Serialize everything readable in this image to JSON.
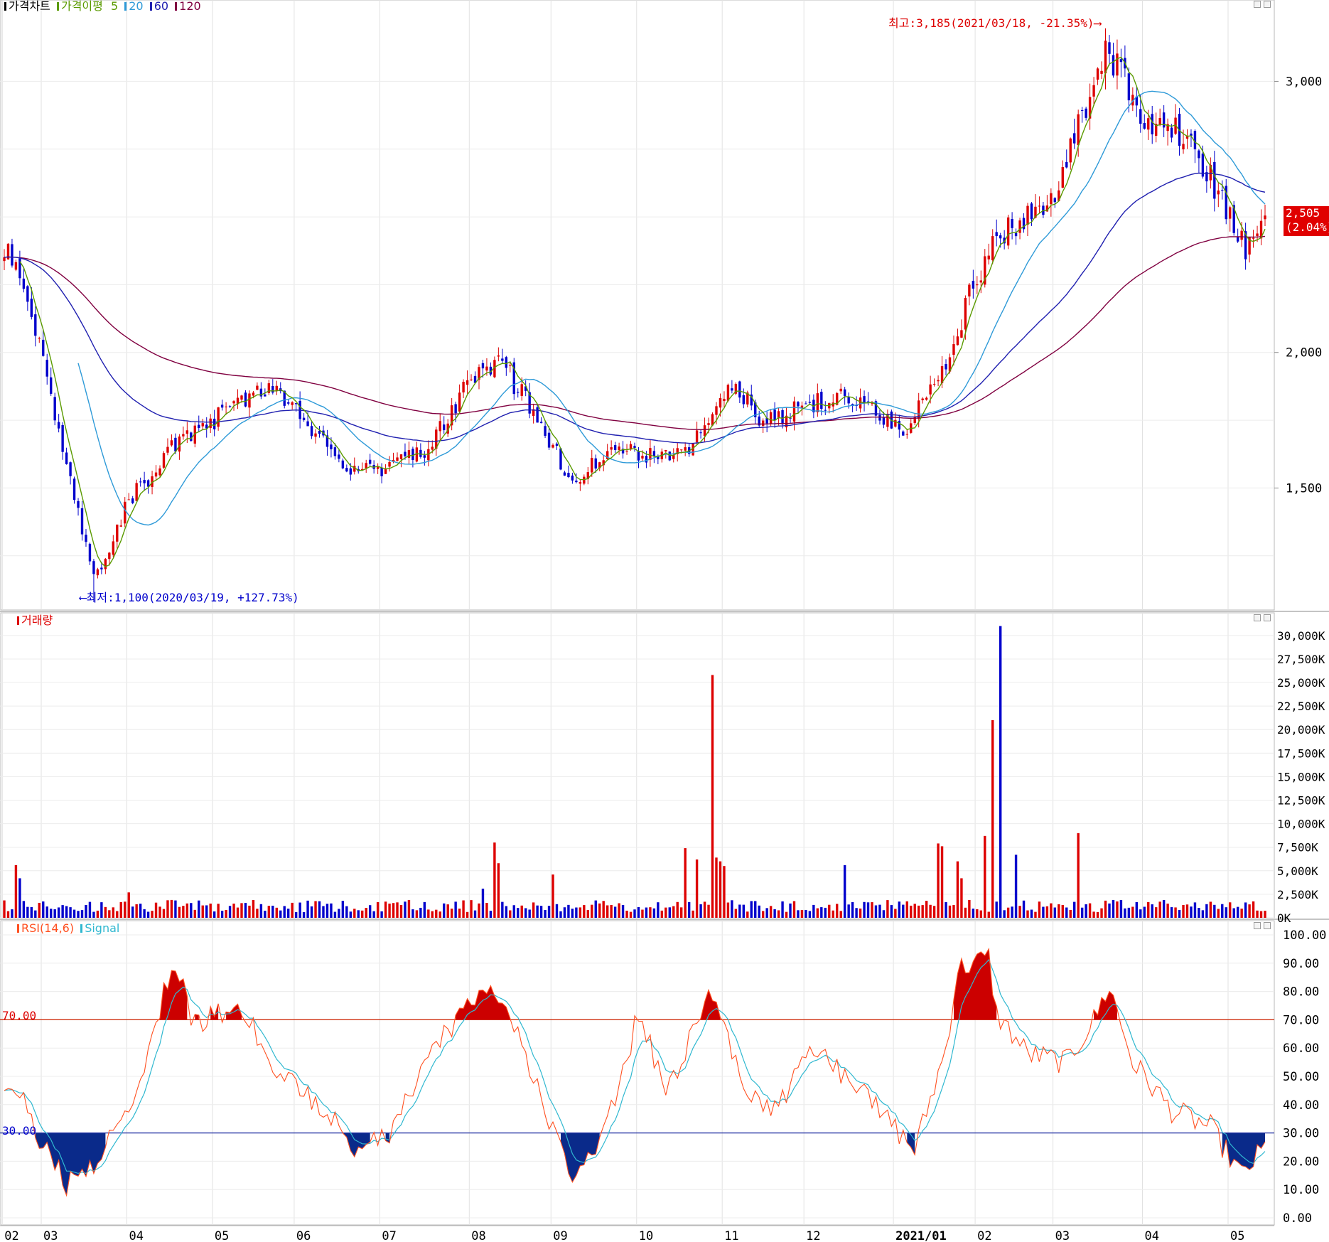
{
  "panels": {
    "price": {
      "legend": {
        "title": "가격차트",
        "ma_label": "가격이평",
        "ma_periods": [
          "5",
          "20",
          "60",
          "120"
        ]
      },
      "current_price_label": "2,505",
      "current_change_label": "(2.04%)",
      "high_note": "최고:3,185(2021/03/18, -21.35%)⟶",
      "low_note": "⟵최저:1,100(2020/03/19, +127.73%)"
    },
    "volume": {
      "legend": {
        "title": "거래량"
      }
    },
    "rsi": {
      "legend": {
        "title": "RSI(14,6)",
        "signal": "Signal"
      },
      "upper_label": "70.00",
      "lower_label": "30.00"
    }
  },
  "colors": {
    "up": "#dd0000",
    "down": "#0000cc",
    "ma5": "#5a9a00",
    "ma20": "#2e9ad8",
    "ma60": "#2020b0",
    "ma120": "#800040",
    "rsi": "#ff5020",
    "signal": "#30b8d0"
  },
  "chart_data": [
    {
      "type": "candlestick",
      "title": "가격차트",
      "x_tick_labels": [
        "02",
        "03",
        "04",
        "05",
        "06",
        "07",
        "08",
        "09",
        "10",
        "11",
        "12",
        "2021/01",
        "02",
        "03",
        "04",
        "05"
      ],
      "y_ticks": [
        "1,500",
        "2,000",
        "3,000"
      ],
      "ylim": [
        1050,
        3300
      ],
      "series": [
        {
          "name": "5",
          "key": "ma5"
        },
        {
          "name": "20",
          "key": "ma20"
        },
        {
          "name": "60",
          "key": "ma60"
        },
        {
          "name": "120",
          "key": "ma120"
        }
      ],
      "anchor_path": [
        [
          "2020-02-20",
          2350
        ],
        [
          "2020-03-03",
          1900
        ],
        [
          "2020-03-19",
          1160
        ],
        [
          "2020-04-01",
          1450
        ],
        [
          "2020-04-20",
          1680
        ],
        [
          "2020-05-06",
          1780
        ],
        [
          "2020-05-20",
          1880
        ],
        [
          "2020-06-03",
          1760
        ],
        [
          "2020-06-17",
          1580
        ],
        [
          "2020-07-01",
          1560
        ],
        [
          "2020-07-17",
          1650
        ],
        [
          "2020-08-03",
          1900
        ],
        [
          "2020-08-12",
          1980
        ],
        [
          "2020-08-26",
          1750
        ],
        [
          "2020-09-08",
          1530
        ],
        [
          "2020-09-22",
          1640
        ],
        [
          "2020-10-06",
          1620
        ],
        [
          "2020-10-20",
          1650
        ],
        [
          "2020-10-28",
          1780
        ],
        [
          "2020-11-05",
          1870
        ],
        [
          "2020-11-16",
          1740
        ],
        [
          "2020-12-01",
          1800
        ],
        [
          "2020-12-18",
          1840
        ],
        [
          "2021-01-05",
          1720
        ],
        [
          "2021-01-18",
          1880
        ],
        [
          "2021-01-29",
          2250
        ],
        [
          "2021-02-05",
          2380
        ],
        [
          "2021-02-16",
          2500
        ],
        [
          "2021-03-02",
          2600
        ],
        [
          "2021-03-12",
          2950
        ],
        [
          "2021-03-18",
          3130
        ],
        [
          "2021-04-01",
          2880
        ],
        [
          "2021-04-15",
          2800
        ],
        [
          "2021-04-27",
          2620
        ],
        [
          "2021-05-07",
          2380
        ],
        [
          "2021-05-14",
          2490
        ]
      ],
      "last_close": 2505,
      "high": {
        "value": 3185,
        "date": "2021/03/18"
      },
      "low": {
        "value": 1100,
        "date": "2020/03/19"
      }
    },
    {
      "type": "bar",
      "title": "거래량",
      "y_ticks": [
        "0K",
        "2,500K",
        "5,000K",
        "7,500K",
        "10,000K",
        "12,500K",
        "15,000K",
        "17,500K",
        "20,000K",
        "22,500K",
        "25,000K",
        "27,500K",
        "30,000K"
      ],
      "ylim": [
        0,
        31500
      ],
      "spikes": [
        [
          "2020-02-20",
          5600
        ],
        [
          "2020-02-21",
          4200
        ],
        [
          "2020-04-01",
          2700
        ],
        [
          "2020-08-06",
          3100
        ],
        [
          "2020-08-11",
          8000
        ],
        [
          "2020-08-12",
          5800
        ],
        [
          "2020-09-01",
          4600
        ],
        [
          "2020-10-19",
          7400
        ],
        [
          "2020-10-22",
          6200
        ],
        [
          "2020-10-28",
          25800
        ],
        [
          "2020-10-29",
          6400
        ],
        [
          "2020-10-30",
          6000
        ],
        [
          "2020-11-02",
          5500
        ],
        [
          "2020-12-15",
          5600
        ],
        [
          "2021-01-18",
          7900
        ],
        [
          "2021-01-19",
          7600
        ],
        [
          "2021-01-25",
          6000
        ],
        [
          "2021-01-26",
          4200
        ],
        [
          "2021-02-03",
          8700
        ],
        [
          "2021-02-05",
          21000
        ],
        [
          "2021-02-09",
          31000
        ],
        [
          "2021-02-15",
          6700
        ],
        [
          "2021-03-09",
          9000
        ]
      ]
    },
    {
      "type": "line",
      "title": "RSI(14,6)",
      "y_ticks": [
        "0.00",
        "10.00",
        "20.00",
        "30.00",
        "40.00",
        "50.00",
        "60.00",
        "70.00",
        "80.00",
        "90.00",
        "100.00"
      ],
      "ylim": [
        0,
        100
      ],
      "reference_lines": [
        70,
        30
      ],
      "series": [
        {
          "name": "RSI(14,6)"
        },
        {
          "name": "Signal"
        }
      ],
      "anchor_path": [
        [
          "2020-02-20",
          48
        ],
        [
          "2020-03-02",
          25
        ],
        [
          "2020-03-10",
          12
        ],
        [
          "2020-03-19",
          18
        ],
        [
          "2020-04-03",
          45
        ],
        [
          "2020-04-14",
          80
        ],
        [
          "2020-04-17",
          90
        ],
        [
          "2020-04-24",
          68
        ],
        [
          "2020-05-04",
          72
        ],
        [
          "2020-05-11",
          78
        ],
        [
          "2020-05-20",
          58
        ],
        [
          "2020-06-01",
          45
        ],
        [
          "2020-06-15",
          35
        ],
        [
          "2020-06-22",
          25
        ],
        [
          "2020-07-03",
          28
        ],
        [
          "2020-07-16",
          55
        ],
        [
          "2020-08-05",
          80
        ],
        [
          "2020-08-12",
          80
        ],
        [
          "2020-08-28",
          40
        ],
        [
          "2020-09-07",
          14
        ],
        [
          "2020-09-18",
          28
        ],
        [
          "2020-10-01",
          72
        ],
        [
          "2020-10-12",
          45
        ],
        [
          "2020-10-28",
          80
        ],
        [
          "2020-11-10",
          45
        ],
        [
          "2020-11-20",
          38
        ],
        [
          "2020-12-01",
          60
        ],
        [
          "2020-12-16",
          50
        ],
        [
          "2021-01-04",
          30
        ],
        [
          "2021-01-08",
          24
        ],
        [
          "2021-01-20",
          60
        ],
        [
          "2021-01-25",
          88
        ],
        [
          "2021-02-04",
          92
        ],
        [
          "2021-02-08",
          72
        ],
        [
          "2021-02-18",
          58
        ],
        [
          "2021-03-04",
          55
        ],
        [
          "2021-03-15",
          70
        ],
        [
          "2021-03-19",
          82
        ],
        [
          "2021-03-29",
          55
        ],
        [
          "2021-04-12",
          38
        ],
        [
          "2021-04-26",
          32
        ],
        [
          "2021-05-06",
          15
        ],
        [
          "2021-05-14",
          25
        ]
      ]
    }
  ]
}
